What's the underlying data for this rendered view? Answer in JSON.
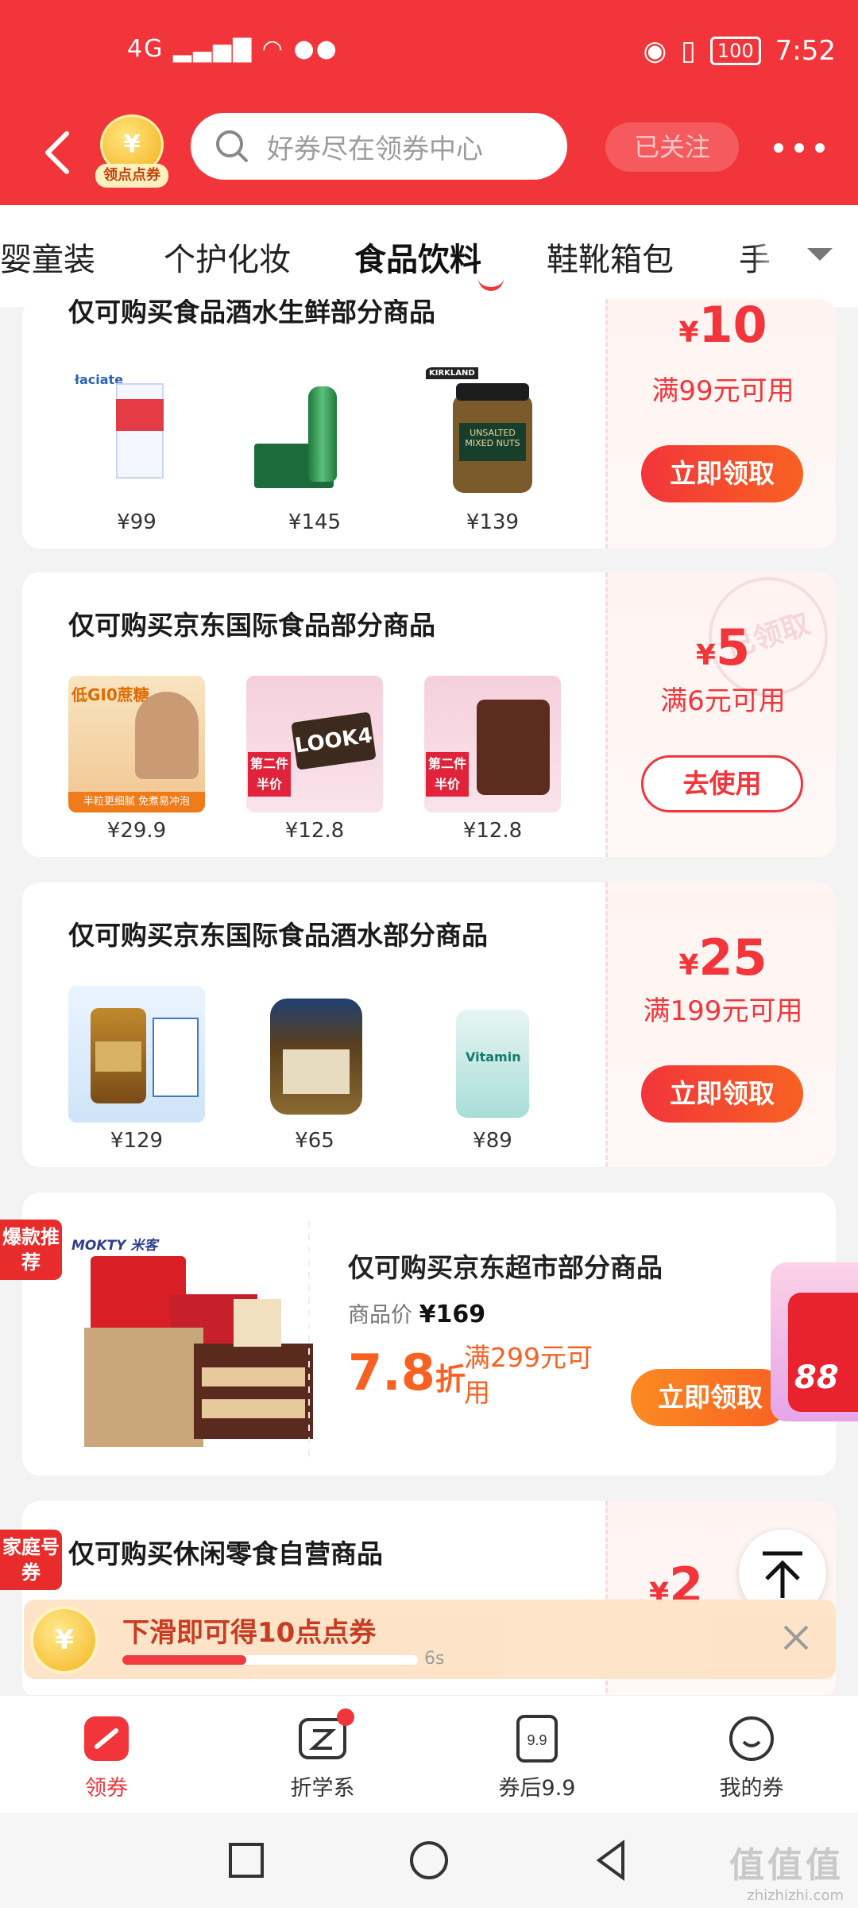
{
  "status": {
    "network": "4G",
    "battery": "100",
    "time": "7:52"
  },
  "header": {
    "points_label": "领点点券",
    "coin_symbol": "¥",
    "search_placeholder": "好券尽在领券中心",
    "follow_label": "已关注"
  },
  "tabs": [
    {
      "label": "母婴童装"
    },
    {
      "label": "个护化妆"
    },
    {
      "label": "食品饮料",
      "active": true
    },
    {
      "label": "鞋靴箱包"
    },
    {
      "label": "手"
    }
  ],
  "coupons": [
    {
      "title": "仅可购买食品酒水生鲜部分商品",
      "currency": "¥",
      "amount": "10",
      "condition": "满99元可用",
      "button": "立即领取",
      "products": [
        {
          "price": "¥99"
        },
        {
          "price": "¥145"
        },
        {
          "price": "¥139"
        }
      ]
    },
    {
      "title": "仅可购买京东国际食品部分商品",
      "currency": "¥",
      "amount": "5",
      "condition": "满6元可用",
      "button": "去使用",
      "stamp": "已领取",
      "products": [
        {
          "price": "¥29.9"
        },
        {
          "price": "¥12.8"
        },
        {
          "price": "¥12.8"
        }
      ],
      "product_texts": {
        "oat_tag": "低GI0蔗糖",
        "oat_bar": "半粒更细腻 免煮易冲泡",
        "half_price": "第二件 半价",
        "look": "LOOK4"
      }
    },
    {
      "title": "仅可购买京东国际食品酒水部分商品",
      "currency": "¥",
      "amount": "25",
      "condition": "满199元可用",
      "button": "立即领取",
      "products": [
        {
          "price": "¥129"
        },
        {
          "price": "¥65"
        },
        {
          "price": "¥89"
        }
      ],
      "product_texts": {
        "vitamin": "Vitamin"
      }
    }
  ],
  "product_texts": {
    "milk_brand": "łaciate",
    "kirkland": "KIRKLAND",
    "nuts_label": "UNSALTED MIXED NUTS"
  },
  "promo": {
    "tag": "爆款推荐",
    "brand": "MOKTY 米客",
    "title": "仅可购买京东超市部分商品",
    "price_label": "商品价",
    "price": "¥169",
    "discount": "7.8",
    "discount_unit": "折",
    "condition": "满299元可用",
    "button": "立即领取"
  },
  "coupon4": {
    "tag": "家庭号券",
    "title": "仅可购买休闲零食自营商品",
    "currency": "¥",
    "amount": "2"
  },
  "red_packet": {
    "number": "88"
  },
  "reward": {
    "text": "下滑即可得10点点券",
    "seconds": "6s",
    "progress": 0.42
  },
  "bottom_nav": [
    {
      "label": "领券",
      "active": true
    },
    {
      "label": "折学系",
      "badge": true
    },
    {
      "label": "券后9.9",
      "icon_text": "9.9"
    },
    {
      "label": "我的券"
    }
  ],
  "watermark": {
    "big": "值值值",
    "small": "zhizhizhi.com"
  },
  "colors": {
    "brand_red": "#f2353a",
    "orange": "#f86122"
  }
}
